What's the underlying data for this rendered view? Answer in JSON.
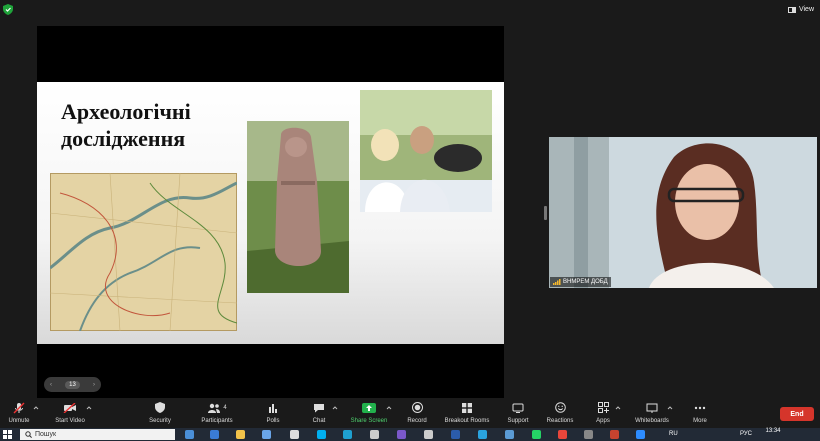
{
  "window": {
    "view_label": "View"
  },
  "slide": {
    "title": "Археологічні дослідження",
    "page": "13"
  },
  "participant": {
    "name": "ВНМРЕМ ДОБД"
  },
  "toolbar": {
    "unmute": "Unmute",
    "start_video": "Start Video",
    "security": "Security",
    "participants": "Participants",
    "participants_count": "4",
    "polls": "Polls",
    "chat": "Chat",
    "share_screen": "Share Screen",
    "record": "Record",
    "breakout_rooms": "Breakout Rooms",
    "support": "Support",
    "reactions": "Reactions",
    "apps": "Apps",
    "whiteboards": "Whiteboards",
    "more": "More",
    "end": "End"
  },
  "taskbar": {
    "search_placeholder": "Пошук",
    "lang": "RU",
    "lang2": "РУС",
    "time": "13:34"
  },
  "colors": {
    "share_green": "#22b14c",
    "end_red": "#d5352b",
    "toolbar_bg": "#1a1a1a"
  }
}
